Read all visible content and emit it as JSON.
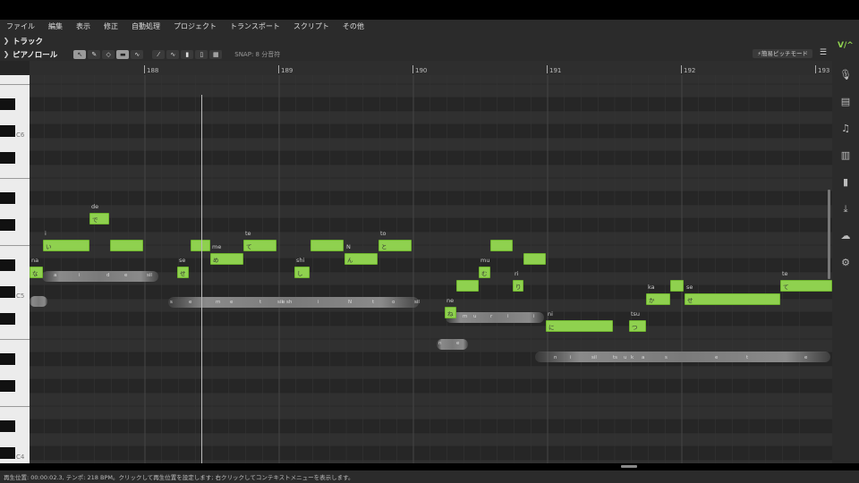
{
  "menu": [
    "ファイル",
    "編集",
    "表示",
    "修正",
    "自動処理",
    "プロジェクト",
    "トランスポート",
    "スクリプト",
    "その他"
  ],
  "track_row": {
    "label": "トラック"
  },
  "pianoroll_row": {
    "label": "ピアノロール",
    "snap": "SNAP:  8 分音符",
    "pitch_button": "⚡簡易ピッチモード"
  },
  "ruler": [
    "188",
    "189",
    "190",
    "191",
    "192",
    "193"
  ],
  "keys": {
    "c6": "C6",
    "c5": "C5",
    "c4": "C4"
  },
  "notes": [
    {
      "lyric": "な",
      "phoneme": "na"
    },
    {
      "lyric": "い",
      "phoneme": "i"
    },
    {
      "lyric": "で",
      "phoneme": "de"
    },
    {
      "lyric": "せ",
      "phoneme": "se"
    },
    {
      "lyric": "め",
      "phoneme": "me"
    },
    {
      "lyric": "て",
      "phoneme": "te"
    },
    {
      "lyric": "し",
      "phoneme": "shi"
    },
    {
      "lyric": "ん",
      "phoneme": "N"
    },
    {
      "lyric": "と",
      "phoneme": "to"
    },
    {
      "lyric": "ね",
      "phoneme": "ne"
    },
    {
      "lyric": "む",
      "phoneme": "mu"
    },
    {
      "lyric": "り",
      "phoneme": "ri"
    },
    {
      "lyric": "に",
      "phoneme": "ni"
    },
    {
      "lyric": "つ",
      "phoneme": "tsu"
    },
    {
      "lyric": "か",
      "phoneme": "ka"
    },
    {
      "lyric": "せ",
      "phoneme": "se"
    },
    {
      "lyric": "て",
      "phoneme": "te"
    }
  ],
  "wave_labels": [
    "a",
    "i",
    "d",
    "e",
    "sil",
    "s",
    "e",
    "m",
    "e",
    "t",
    "e",
    "sil",
    "sh",
    "i",
    "N",
    "t",
    "o",
    "sil",
    "n",
    "e",
    "m",
    "u",
    "r",
    "i",
    "i",
    "n",
    "i",
    "sil",
    "ts",
    "u",
    "k",
    "a",
    "s",
    "e",
    "t",
    "e"
  ],
  "colors": {
    "note": "#8fd14f",
    "background": "#2d2d2d"
  },
  "status": "再生位置: 00:00:02.3, テンポ: 218 BPM。クリックして再生位置を設定します; 右クリックしてコンテキストメニューを表示します。"
}
